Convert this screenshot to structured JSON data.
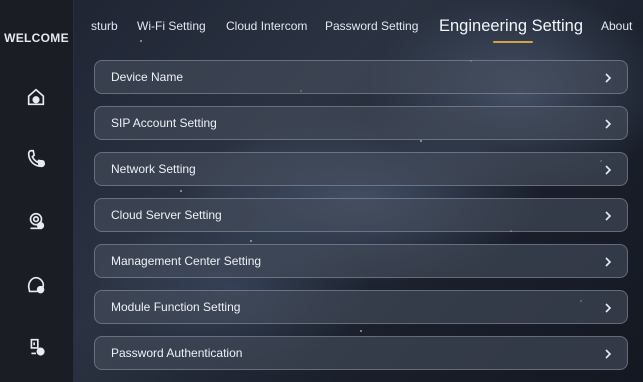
{
  "sidebar": {
    "welcome_label": "WELCOME",
    "icons": [
      "home-icon",
      "phone-icon",
      "camera-icon",
      "message-icon",
      "settings-icon"
    ]
  },
  "tabs": [
    {
      "label": "sturb"
    },
    {
      "label": "Wi-Fi Setting"
    },
    {
      "label": "Cloud Intercom"
    },
    {
      "label": "Password Setting"
    },
    {
      "label": "Engineering Setting",
      "active": true
    },
    {
      "label": "About"
    }
  ],
  "menu": [
    {
      "label": "Device Name"
    },
    {
      "label": "SIP Account Setting"
    },
    {
      "label": "Network Setting"
    },
    {
      "label": "Cloud Server Setting"
    },
    {
      "label": "Management Center Setting"
    },
    {
      "label": "Module Function Setting"
    },
    {
      "label": "Password Authentication"
    }
  ],
  "colors": {
    "accent": "#d4a04a",
    "sidebar_bg": "#1a1d24",
    "row_bg": "#464e5c"
  }
}
